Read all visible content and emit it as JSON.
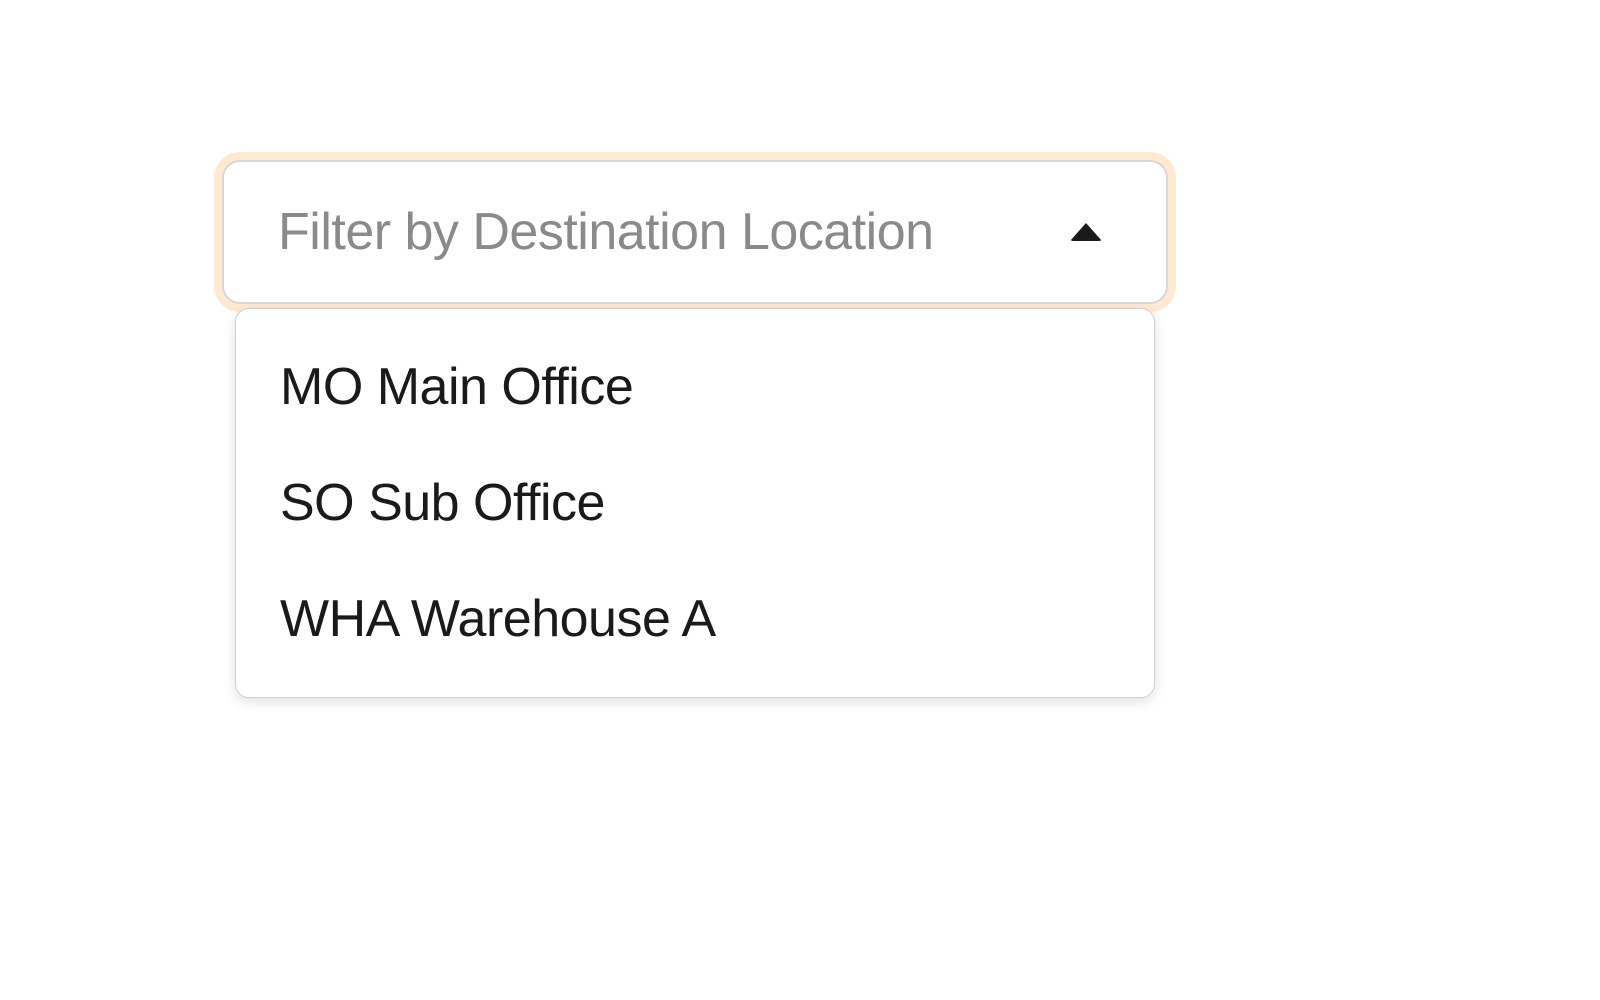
{
  "filter": {
    "placeholder": "Filter by Destination Location",
    "options": [
      {
        "label": "MO Main Office"
      },
      {
        "label": "SO Sub Office"
      },
      {
        "label": "WHA Warehouse A"
      }
    ]
  }
}
